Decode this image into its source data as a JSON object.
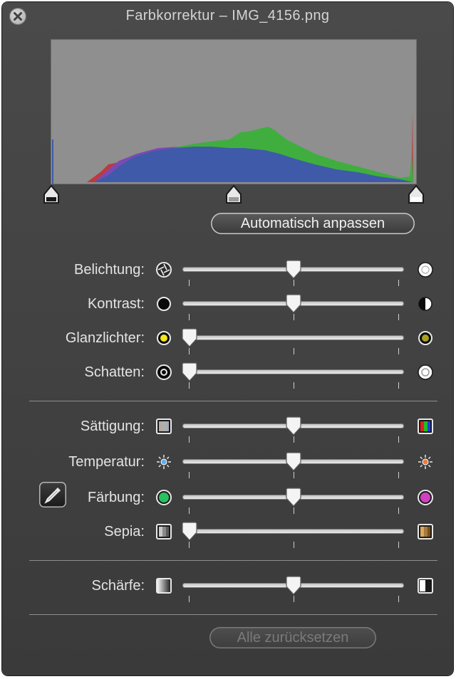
{
  "window": {
    "title": "Farbkorrektur – IMG_4156.png"
  },
  "buttons": {
    "auto_adjust": "Automatisch anpassen",
    "reset_all": "Alle zurücksetzen"
  },
  "histogram": {
    "colors": {
      "background": "#8f8f8f",
      "red": "#c0393a",
      "green": "#3fae3f",
      "blue": "#3f5aa8",
      "purple": "#7a4ab4"
    },
    "levels": {
      "black_point": 0.0,
      "midpoint": 0.5,
      "white_point": 1.0
    }
  },
  "adjustments": [
    {
      "label": "Belichtung:",
      "value": 0.5,
      "icon_left": "aperture-icon",
      "icon_right": "bright-circle-icon"
    },
    {
      "label": "Kontrast:",
      "value": 0.5,
      "icon_left": "black-dot-icon",
      "icon_right": "half-circle-icon"
    },
    {
      "label": "Glanzlichter:",
      "value": 0.0,
      "icon_left": "yellow-dot-icon",
      "icon_right": "dark-yellow-dot-icon"
    },
    {
      "label": "Schatten:",
      "value": 0.0,
      "icon_left": "black-ring-icon",
      "icon_right": "white-circle-icon"
    }
  ],
  "color_adjustments": [
    {
      "label": "Sättigung:",
      "value": 0.5,
      "icon_left": "desaturated-swatch-icon",
      "icon_right": "rgb-swatch-icon"
    },
    {
      "label": "Temperatur:",
      "value": 0.5,
      "icon_left": "cool-sun-icon",
      "icon_right": "warm-sun-icon"
    },
    {
      "label": "Färbung:",
      "value": 0.5,
      "icon_left": "green-dot-icon",
      "icon_right": "magenta-dot-icon"
    },
    {
      "label": "Sepia:",
      "value": 0.0,
      "icon_left": "gray-swatch-icon",
      "icon_right": "sepia-swatch-icon"
    }
  ],
  "sharpness": [
    {
      "label": "Schärfe:",
      "value": 0.5,
      "icon_left": "soft-gradient-icon",
      "icon_right": "sharp-edge-icon"
    }
  ],
  "eyedropper": {
    "icon": "eyedropper-icon"
  },
  "colors": {
    "panel": "#424242",
    "label_text": "#e4e4e4",
    "disabled_text": "#7a7a7a"
  }
}
